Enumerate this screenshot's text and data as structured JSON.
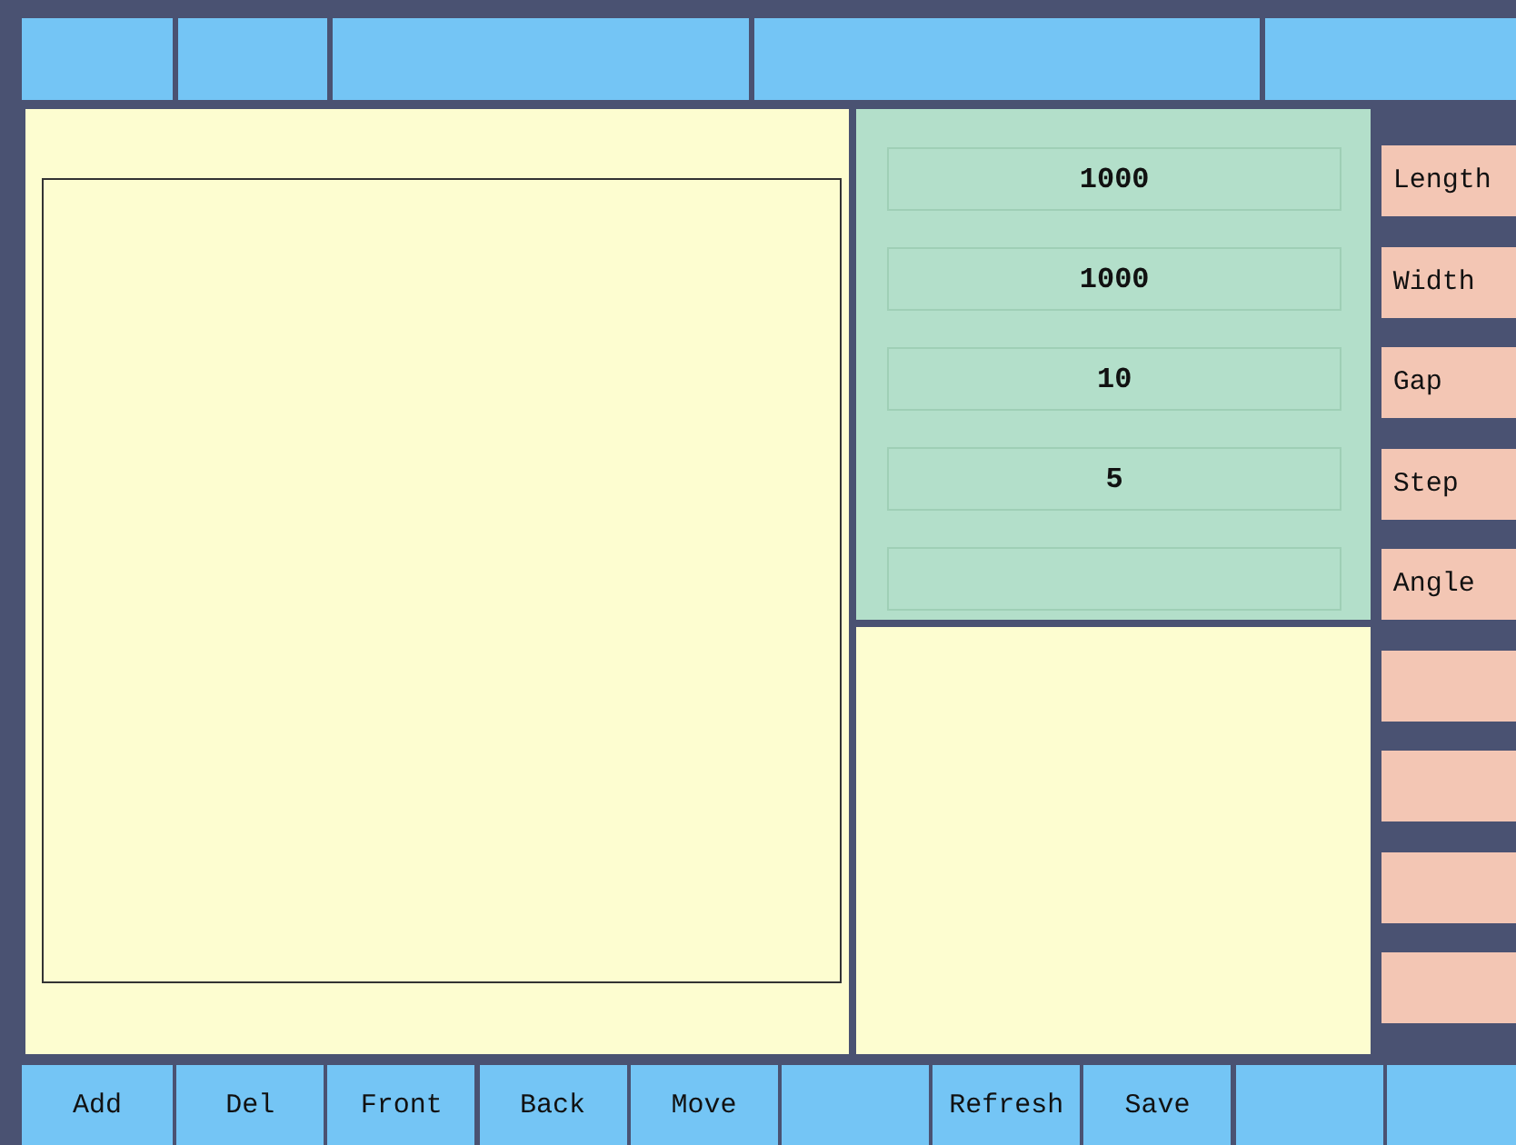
{
  "top_bar": [
    {
      "kind": "blank"
    },
    {
      "kind": "blank"
    },
    {
      "kind": "blank"
    },
    {
      "kind": "blank"
    },
    {
      "kind": "blank"
    }
  ],
  "fields": [
    {
      "kind": "value",
      "value": "1000"
    },
    {
      "kind": "value",
      "value": "1000"
    },
    {
      "kind": "value",
      "value": "10"
    },
    {
      "kind": "value",
      "value": "5"
    },
    {
      "kind": "blank"
    }
  ],
  "side_buttons": [
    {
      "kind": "label",
      "label": "Length"
    },
    {
      "kind": "label",
      "label": "Width"
    },
    {
      "kind": "label",
      "label": "Gap"
    },
    {
      "kind": "label",
      "label": "Step"
    },
    {
      "kind": "label",
      "label": "Angle"
    },
    {
      "kind": "blank"
    },
    {
      "kind": "blank"
    },
    {
      "kind": "blank"
    },
    {
      "kind": "blank"
    }
  ],
  "bottom_bar": [
    {
      "kind": "label",
      "label": "Add"
    },
    {
      "kind": "label",
      "label": "Del"
    },
    {
      "kind": "label",
      "label": "Front"
    },
    {
      "kind": "label",
      "label": "Back"
    },
    {
      "kind": "label",
      "label": "Move"
    },
    {
      "kind": "blank"
    },
    {
      "kind": "label",
      "label": "Refresh"
    },
    {
      "kind": "label",
      "label": "Save"
    },
    {
      "kind": "blank"
    },
    {
      "kind": "blank"
    }
  ]
}
